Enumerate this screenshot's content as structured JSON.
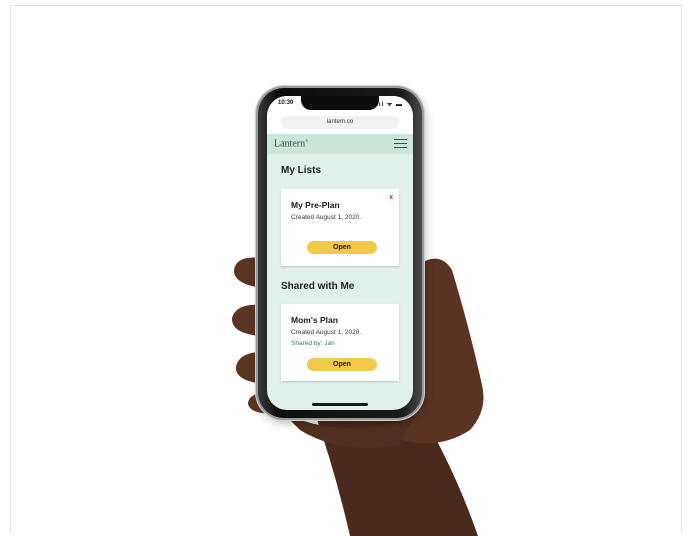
{
  "status": {
    "time": "10:30",
    "icons": "..ıl ᯤ ▬"
  },
  "browser": {
    "url": "lantern.co"
  },
  "app": {
    "logo": "Lantern",
    "logo_mark": "®"
  },
  "my_lists": {
    "heading": "My Lists",
    "cards": [
      {
        "title": "My Pre-Plan",
        "created": "Created August 1, 2020.",
        "action": "Open",
        "close": "x"
      }
    ]
  },
  "shared": {
    "heading": "Shared with Me",
    "cards": [
      {
        "title": "Mom's Plan",
        "created": "Created August 1, 2020.",
        "shared_by": "Shared by: Jan",
        "action": "Open"
      }
    ]
  },
  "colors": {
    "accent": "#f2c94c",
    "app_bg": "#dff1e9",
    "header_bg": "#c9e6d8",
    "shared_text": "#2f7d66",
    "close": "#c23a2b"
  }
}
